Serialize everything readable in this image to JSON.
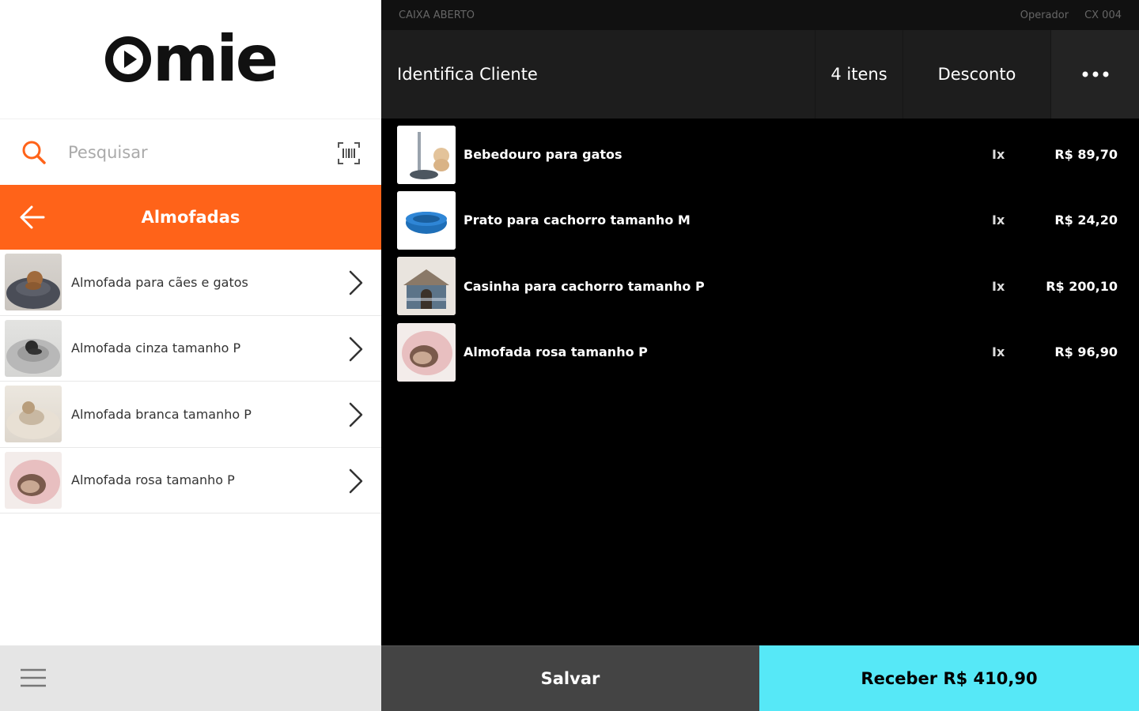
{
  "brand": {
    "logo_text": "mie",
    "accent": "#ff6319",
    "receive_color": "#56e8f7"
  },
  "search": {
    "placeholder": "Pesquisar",
    "icon": "search-icon",
    "scan_icon": "barcode-icon"
  },
  "category": {
    "title": "Almofadas",
    "back_icon": "arrow-left-icon"
  },
  "products": [
    {
      "name": "Almofada para cães e gatos",
      "image": "gray-round-pet-bed"
    },
    {
      "name": "Almofada cinza tamanho P",
      "image": "gray-fluffy-pet-bed"
    },
    {
      "name": "Almofada branca tamanho P",
      "image": "white-pet-bed"
    },
    {
      "name": "Almofada rosa tamanho P",
      "image": "pink-cave-pet-bed"
    }
  ],
  "bottom": {
    "menu_icon": "hamburger-menu-icon"
  },
  "status": {
    "left": "CAIXA ABERTO",
    "operator": "Operador",
    "register": "CX 004"
  },
  "toolbar": {
    "client": "Identifica Cliente",
    "items": "4 itens",
    "discount": "Desconto",
    "more_icon": "more-dots-icon"
  },
  "cart": [
    {
      "name": "Bebedouro para gatos",
      "qty": "Ix",
      "price": "R$ 89,70",
      "image": "cat-water-fountain"
    },
    {
      "name": "Prato para cachorro tamanho M",
      "qty": "Ix",
      "price": "R$ 24,20",
      "image": "blue-dog-bowl"
    },
    {
      "name": "Casinha para cachorro tamanho P",
      "qty": "Ix",
      "price": "R$ 200,10",
      "image": "dog-house"
    },
    {
      "name": "Almofada rosa tamanho P",
      "qty": "Ix",
      "price": "R$ 96,90",
      "image": "pink-cave-pet-bed"
    }
  ],
  "footer": {
    "save": "Salvar",
    "receive": "Receber R$ 410,90"
  }
}
